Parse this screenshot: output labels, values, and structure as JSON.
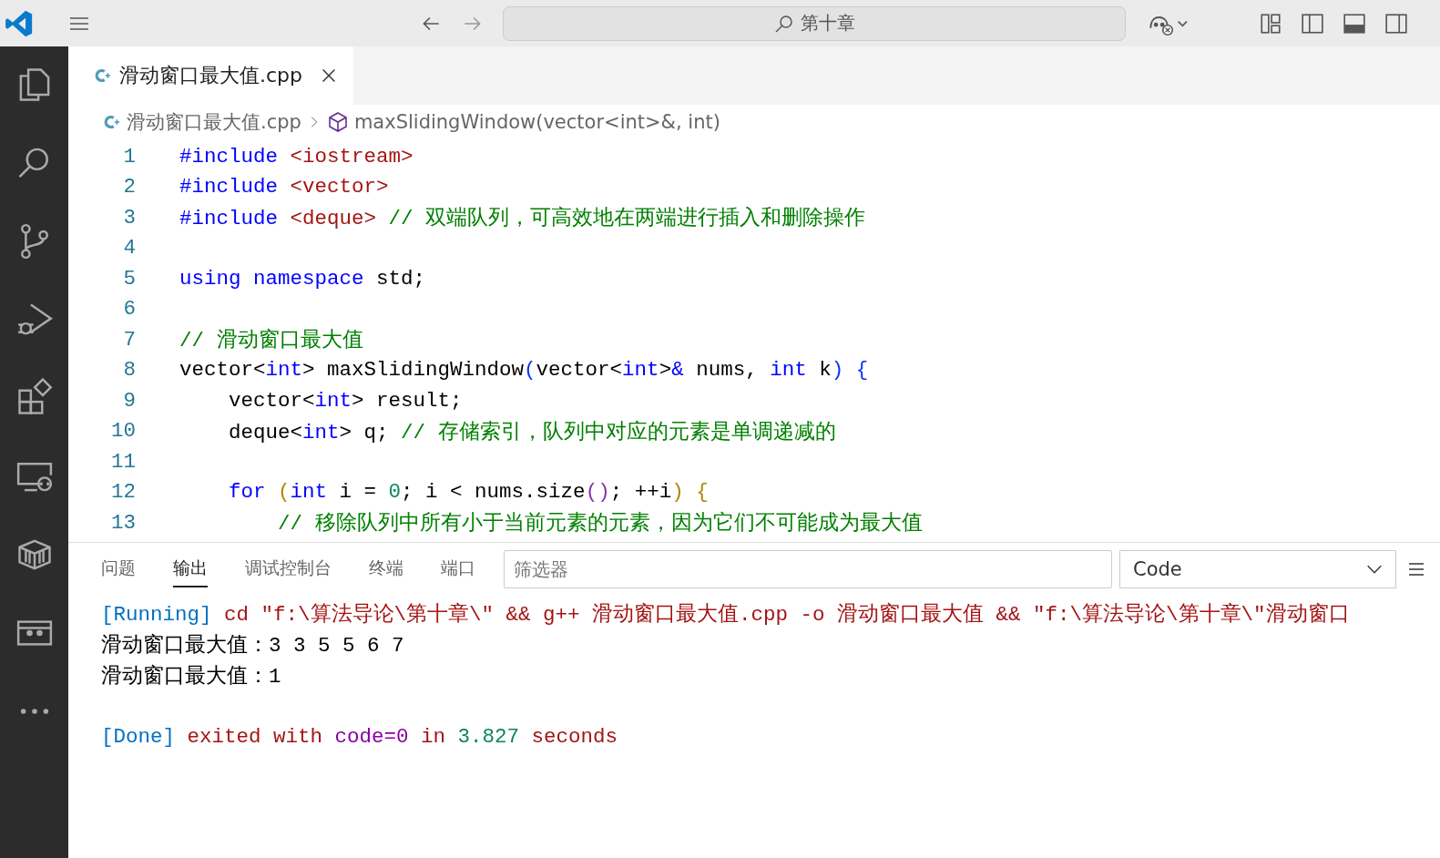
{
  "title_bar": {
    "search": "第十章"
  },
  "activity_bar": [
    {
      "kind": "files",
      "selected": false
    },
    {
      "kind": "search",
      "selected": false
    },
    {
      "kind": "source-control",
      "selected": false
    },
    {
      "kind": "run-debug",
      "selected": false
    },
    {
      "kind": "extensions",
      "selected": false
    },
    {
      "kind": "remote",
      "selected": false
    },
    {
      "kind": "package",
      "selected": false
    },
    {
      "kind": "screen",
      "selected": false
    },
    {
      "kind": "more",
      "selected": false
    }
  ],
  "tabs": [
    {
      "label": "滑动窗口最大值.cpp",
      "selected": true
    }
  ],
  "breadcrumb": {
    "file": "滑动窗口最大值.cpp",
    "symbol": "maxSlidingWindow(vector<int>&, int)"
  },
  "editor": {
    "lines": [
      {
        "number": "1",
        "tokens": [
          {
            "kind": "keyword",
            "text": "#include "
          },
          {
            "kind": "string",
            "text": "<iostream>"
          }
        ]
      },
      {
        "number": "2",
        "tokens": [
          {
            "kind": "keyword",
            "text": "#include "
          },
          {
            "kind": "string",
            "text": "<vector>"
          }
        ]
      },
      {
        "number": "3",
        "tokens": [
          {
            "kind": "keyword",
            "text": "#include "
          },
          {
            "kind": "string",
            "text": "<deque>"
          },
          {
            "kind": "comment",
            "text": " // 双端队列，可高效地在两端进行插入和删除操作"
          }
        ]
      },
      {
        "number": "4"
      },
      {
        "number": "5",
        "tokens": [
          {
            "kind": "keyword",
            "text": "using namespace"
          },
          {
            "kind": "plain",
            "text": " std;"
          }
        ]
      },
      {
        "number": "6"
      },
      {
        "number": "7",
        "tokens": [
          {
            "kind": "comment",
            "text": "// 滑动窗口最大值"
          }
        ]
      },
      {
        "number": "8",
        "tokens": [
          {
            "kind": "plain",
            "text": "vector<"
          },
          {
            "kind": "keyword",
            "text": "int"
          },
          {
            "kind": "plain",
            "text": "> maxSlidingWindow"
          },
          {
            "kind": "bracket1",
            "text": "("
          },
          {
            "kind": "plain",
            "text": "vector<"
          },
          {
            "kind": "keyword",
            "text": "int"
          },
          {
            "kind": "plain",
            "text": ">"
          },
          {
            "kind": "keyword",
            "text": "&"
          },
          {
            "kind": "plain",
            "text": " nums, "
          },
          {
            "kind": "keyword",
            "text": "int"
          },
          {
            "kind": "plain",
            "text": " k"
          },
          {
            "kind": "bracket1",
            "text": ")"
          },
          {
            "kind": "bracket1",
            "text": " {"
          }
        ]
      },
      {
        "number": "9",
        "tokens": [
          {
            "kind": "plain",
            "text": "    vector<"
          },
          {
            "kind": "keyword",
            "text": "int"
          },
          {
            "kind": "plain",
            "text": "> result;"
          }
        ]
      },
      {
        "number": "10",
        "tokens": [
          {
            "kind": "plain",
            "text": "    deque<"
          },
          {
            "kind": "keyword",
            "text": "int"
          },
          {
            "kind": "plain",
            "text": "> q; "
          },
          {
            "kind": "comment",
            "text": "// 存储索引，队列中对应的元素是单调递减的"
          }
        ]
      },
      {
        "number": "11"
      },
      {
        "number": "12",
        "tokens": [
          {
            "kind": "keyword",
            "text": "    for"
          },
          {
            "kind": "bracket2",
            "text": " ("
          },
          {
            "kind": "keyword",
            "text": "int"
          },
          {
            "kind": "plain",
            "text": " i = "
          },
          {
            "kind": "number",
            "text": "0"
          },
          {
            "kind": "plain",
            "text": "; i < nums.size"
          },
          {
            "kind": "bracket3",
            "text": "()"
          },
          {
            "kind": "plain",
            "text": "; ++i"
          },
          {
            "kind": "bracket2",
            "text": ")"
          },
          {
            "kind": "bracket2",
            "text": " {"
          }
        ]
      },
      {
        "number": "13",
        "tokens": [
          {
            "kind": "comment",
            "text": "        // 移除队列中所有小于当前元素的元素，因为它们不可能成为最大值"
          }
        ]
      }
    ]
  },
  "panel": {
    "tabs": [
      {
        "label": "问题",
        "selected": false
      },
      {
        "label": "输出",
        "selected": true
      },
      {
        "label": "调试控制台",
        "selected": false
      },
      {
        "label": "终端",
        "selected": false
      },
      {
        "label": "端口",
        "selected": false
      }
    ],
    "filter": {
      "placeholder": "筛选器"
    },
    "channel": "Code",
    "output": {
      "start": [
        {
          "kind": "tag",
          "text": "[Running]"
        },
        {
          "kind": "red",
          "text": " cd \"f:\\算法导论\\第十章\\\" && g++ 滑动窗口最大值.cpp -o 滑动窗口最大值 && \"f:\\算法导论\\第十章\\\"滑动窗口"
        }
      ],
      "program_output": [
        "滑动窗口最大值：3 3 5 5 6 7",
        "滑动窗口最大值：1"
      ],
      "done": [
        {
          "kind": "tag",
          "text": "[Done]"
        },
        {
          "kind": "red",
          "text": " exited with "
        },
        {
          "kind": "purple",
          "text": "code=0"
        },
        {
          "kind": "red",
          "text": " in "
        },
        {
          "kind": "green",
          "text": "3.827"
        },
        {
          "kind": "red",
          "text": " seconds"
        }
      ]
    }
  }
}
